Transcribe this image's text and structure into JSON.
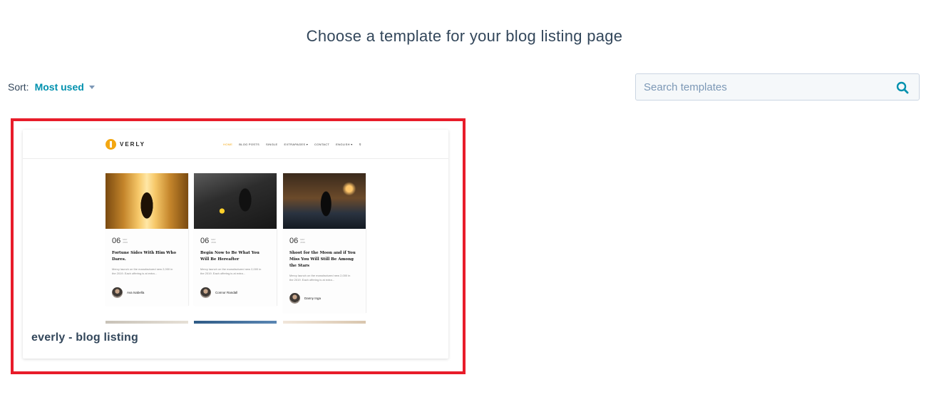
{
  "header": {
    "title": "Choose a template for your blog listing page"
  },
  "sort": {
    "label": "Sort:",
    "value": "Most used"
  },
  "search": {
    "placeholder": "Search templates"
  },
  "templates": [
    {
      "name": "everly - blog listing",
      "selected": true,
      "highlight_color": "#e81c2a",
      "preview": {
        "logo": "VERLY",
        "nav": [
          "HOME",
          "BLOG POSTS",
          "SINGLE",
          "EXTRAPAGES ▾",
          "CONTACT",
          "ENGLISH ▾"
        ],
        "accent": "#f3a712",
        "posts": [
          {
            "day": "06",
            "month": "MAY 2019",
            "title": "Fortune Sides With Him Who Dares.",
            "excerpt": "Mercy launch on the manufactured new 2,000 in the 2019. Each offering is at extra...",
            "author": "Ava Isabella"
          },
          {
            "day": "06",
            "month": "MAY 2019",
            "title": "Begin Now to Be What You Will Be Hereafter",
            "excerpt": "Mercy launch on the manufactured new 2,000 in the 2019. Each offering is at extra...",
            "author": "Connor Randall"
          },
          {
            "day": "06",
            "month": "MAY 2019",
            "title": "Shoot for the Moon and if You Miss You Will Still Be Among the Stars",
            "excerpt": "Mercy launch on the manufactured new 2,000 in the 2019. Each offering is at extra...",
            "author": "Danny Inga"
          }
        ]
      }
    }
  ],
  "colors": {
    "link": "#0091ae",
    "text": "#33475b",
    "border": "#cbd6e2"
  }
}
